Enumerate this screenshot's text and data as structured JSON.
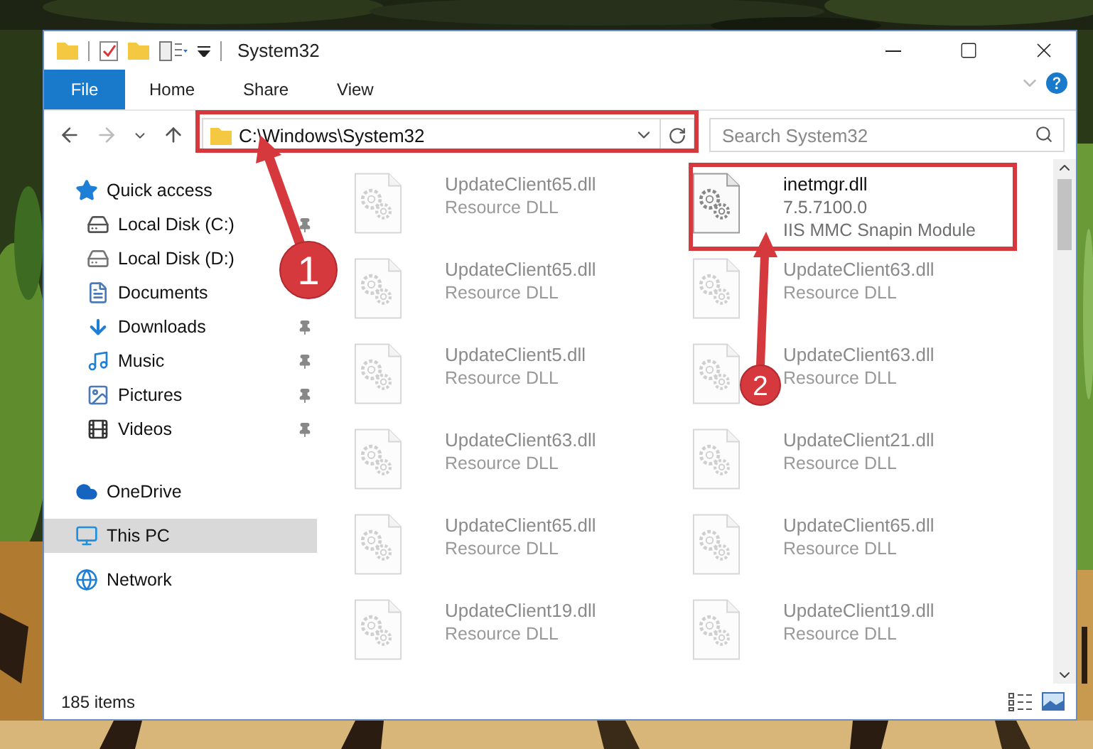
{
  "window": {
    "title": "System32"
  },
  "ribbon": {
    "tabs": [
      {
        "label": "File",
        "kind": "file",
        "selected": false
      },
      {
        "label": "Home",
        "kind": "tab",
        "selected": false
      },
      {
        "label": "Share",
        "kind": "tab",
        "selected": false
      },
      {
        "label": "View",
        "kind": "tab",
        "selected": false
      }
    ]
  },
  "address": {
    "path": "C:\\Windows\\System32"
  },
  "search": {
    "placeholder": "Search System32"
  },
  "nav": {
    "items": [
      {
        "label": "Quick access",
        "kind": "star",
        "selected": false,
        "children": [
          {
            "label": "Local Disk (C:)",
            "kind": "drive-c",
            "pinned": true
          },
          {
            "label": "Local Disk (D:)",
            "kind": "drive",
            "pinned": false
          },
          {
            "label": "Documents",
            "kind": "documents",
            "pinned": false
          },
          {
            "label": "Downloads",
            "kind": "downloads",
            "pinned": true
          },
          {
            "label": "Music",
            "kind": "music",
            "pinned": true
          },
          {
            "label": "Pictures",
            "kind": "pictures",
            "pinned": true
          },
          {
            "label": "Videos",
            "kind": "videos",
            "pinned": true
          }
        ]
      },
      {
        "label": "OneDrive",
        "kind": "cloud",
        "selected": false
      },
      {
        "label": "This PC",
        "kind": "pc",
        "selected": true
      },
      {
        "label": "Network",
        "kind": "network",
        "selected": false
      }
    ]
  },
  "files": [
    {
      "name": "UpdateClient65.dll",
      "details": [
        "Resource DLL"
      ],
      "dimmed": true
    },
    {
      "name": "inetmgr.dll",
      "details": [
        "7.5.7100.0",
        "IIS MMC Snapin Module"
      ],
      "dimmed": false
    },
    {
      "name": "UpdateClient65.dll",
      "details": [
        "Resource DLL"
      ],
      "dimmed": true
    },
    {
      "name": "UpdateClient63.dll",
      "details": [
        "Resource DLL"
      ],
      "dimmed": true
    },
    {
      "name": "UpdateClient5.dll",
      "details": [
        "Resource DLL"
      ],
      "dimmed": true
    },
    {
      "name": "UpdateClient63.dll",
      "details": [
        "Resource DLL"
      ],
      "dimmed": true
    },
    {
      "name": "UpdateClient63.dll",
      "details": [
        "Resource DLL"
      ],
      "dimmed": true
    },
    {
      "name": "UpdateClient21.dll",
      "details": [
        "Resource DLL"
      ],
      "dimmed": true
    },
    {
      "name": "UpdateClient65.dll",
      "details": [
        "Resource DLL"
      ],
      "dimmed": true
    },
    {
      "name": "UpdateClient65.dll",
      "details": [
        "Resource DLL"
      ],
      "dimmed": true
    },
    {
      "name": "UpdateClient19.dll",
      "details": [
        "Resource DLL"
      ],
      "dimmed": true
    },
    {
      "name": "UpdateClient19.dll",
      "details": [
        "Resource DLL"
      ],
      "dimmed": true
    }
  ],
  "status_bar": {
    "count": "185 items"
  },
  "callouts": [
    {
      "number": "1"
    },
    {
      "number": "2"
    }
  ]
}
